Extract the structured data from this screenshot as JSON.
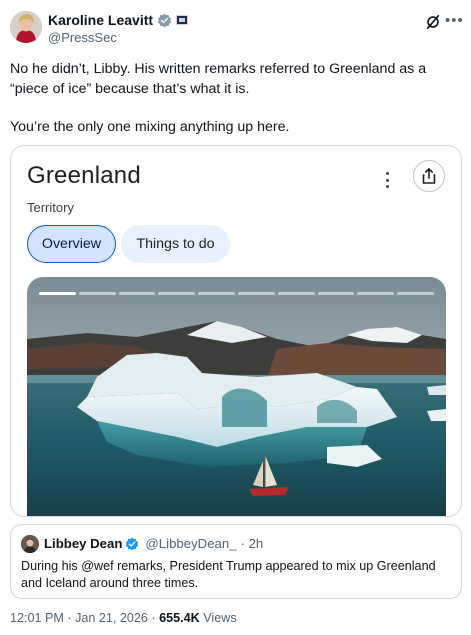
{
  "author": {
    "name": "Karoline Leavitt",
    "handle": "@PressSec",
    "verified_color": "#1d9bf0",
    "affiliate_badge": "government-flag-icon"
  },
  "tweet": {
    "line1": "No he didn’t, Libby. His written remarks referred to Greenland as a “piece of ice” because that’s what it is.",
    "line2": "You’re the only one mixing anything up here."
  },
  "card": {
    "title": "Greenland",
    "subtitle": "Territory",
    "chips": [
      "Overview",
      "Things to do"
    ],
    "image_description_icon": "iceberg-photo"
  },
  "quote": {
    "name": "Libbey Dean",
    "handle": "@LibbeyDean_",
    "time": "· 2h",
    "text": "During his @wef remarks, President Trump appeared to mix up Greenland and Iceland around three times."
  },
  "meta": {
    "time": "12:01 PM · Jan 21, 2026 ·",
    "views_count": "655.4K",
    "views_label": "Views"
  }
}
